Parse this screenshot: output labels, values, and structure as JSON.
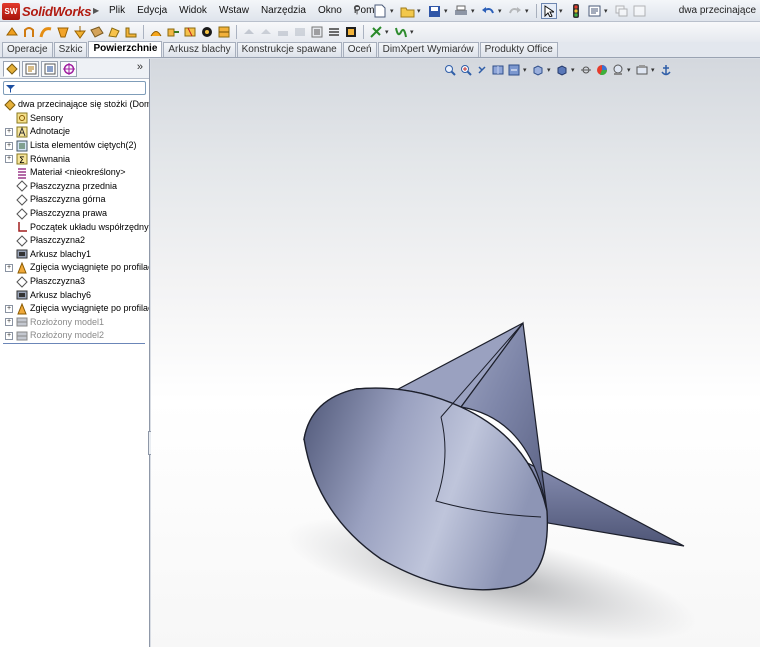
{
  "app": {
    "name": "SolidWorks",
    "logo_mark": "SW",
    "document_title": "dwa przecinające"
  },
  "menu": {
    "items": [
      "Plik",
      "Edycja",
      "Widok",
      "Wstaw",
      "Narzędzia",
      "Okno",
      "Pomoc"
    ]
  },
  "command_tabs": [
    {
      "label": "Operacje",
      "active": false
    },
    {
      "label": "Szkic",
      "active": false
    },
    {
      "label": "Powierzchnie",
      "active": true
    },
    {
      "label": "Arkusz blachy",
      "active": false
    },
    {
      "label": "Konstrukcje spawane",
      "active": false
    },
    {
      "label": "Oceń",
      "active": false
    },
    {
      "label": "DimXpert Wymiarów",
      "active": false
    },
    {
      "label": "Produkty Office",
      "active": false
    }
  ],
  "panel": {
    "more_label": "»",
    "tree": [
      {
        "label": "dwa przecinające się stożki  (Domyś",
        "icon": "part-icon",
        "expander": "",
        "root": true
      },
      {
        "label": "Sensory",
        "icon": "sensor-icon",
        "expander": ""
      },
      {
        "label": "Adnotacje",
        "icon": "annotation-icon",
        "expander": "+"
      },
      {
        "label": "Lista elementów ciętych(2)",
        "icon": "cut-list-icon",
        "expander": "+"
      },
      {
        "label": "Równania",
        "icon": "equations-icon",
        "expander": "+"
      },
      {
        "label": "Materiał <nieokreślony>",
        "icon": "material-icon",
        "expander": ""
      },
      {
        "label": "Płaszczyzna przednia",
        "icon": "plane-icon",
        "expander": ""
      },
      {
        "label": "Płaszczyzna górna",
        "icon": "plane-icon",
        "expander": ""
      },
      {
        "label": "Płaszczyzna prawa",
        "icon": "plane-icon",
        "expander": ""
      },
      {
        "label": "Początek układu współrzędnych",
        "icon": "origin-icon",
        "expander": ""
      },
      {
        "label": "Płaszczyzna2",
        "icon": "plane-icon",
        "expander": ""
      },
      {
        "label": "Arkusz blachy1",
        "icon": "sheet-metal-icon",
        "expander": ""
      },
      {
        "label": "Zgięcia wyciągnięte po profilach",
        "icon": "lofted-bend-icon",
        "expander": "+"
      },
      {
        "label": "Płaszczyzna3",
        "icon": "plane-icon",
        "expander": ""
      },
      {
        "label": "Arkusz blachy6",
        "icon": "sheet-metal-icon",
        "expander": ""
      },
      {
        "label": "Zgięcia wyciągnięte po profilach",
        "icon": "lofted-bend-icon",
        "expander": "+"
      },
      {
        "label": "Rozłożony model1",
        "icon": "flat-pattern-icon",
        "expander": "+",
        "dim": true
      },
      {
        "label": "Rozłożony model2",
        "icon": "flat-pattern-icon",
        "expander": "+",
        "dim": true
      }
    ]
  },
  "colors": {
    "accent": "#b11a10",
    "cone_light": "#c3c8dc",
    "cone_dark": "#5a6283",
    "tree_line": "#6b86b8"
  }
}
